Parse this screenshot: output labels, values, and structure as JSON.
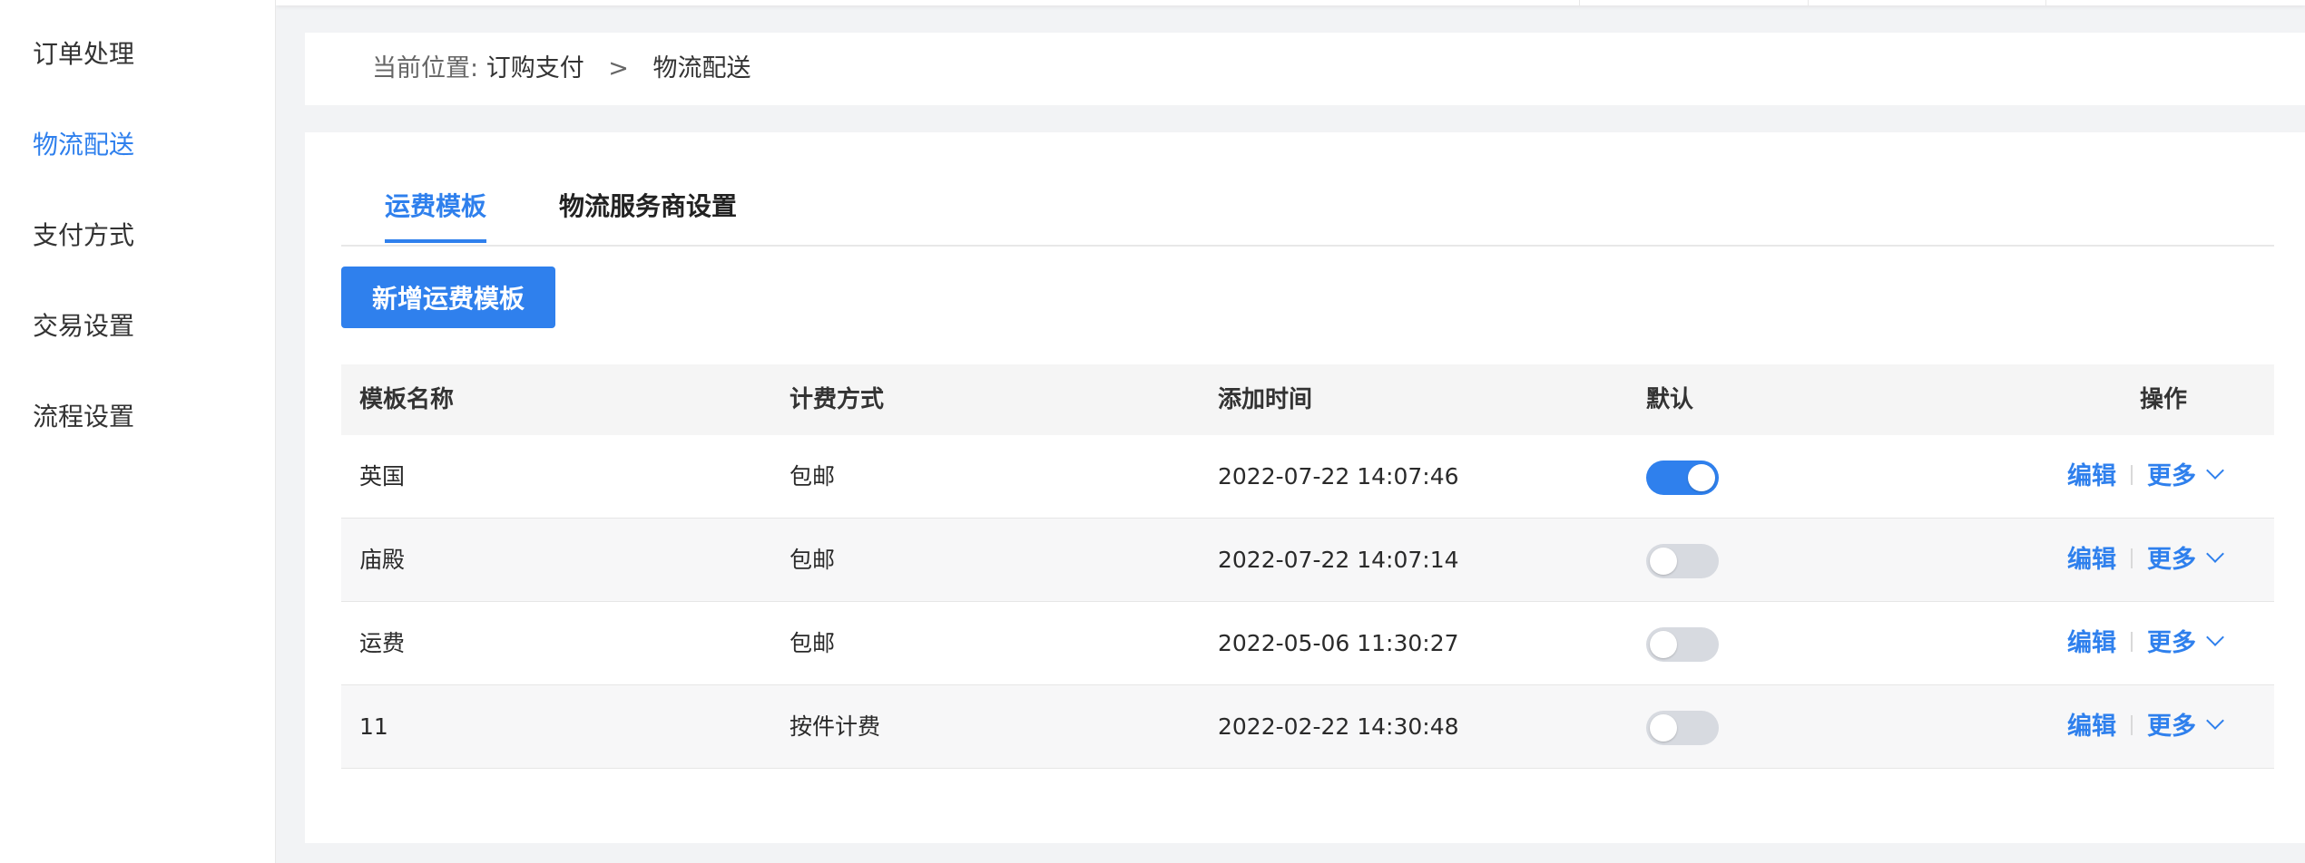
{
  "sidebar": {
    "items": [
      {
        "label": "订单处理",
        "active": false
      },
      {
        "label": "物流配送",
        "active": true
      },
      {
        "label": "支付方式",
        "active": false
      },
      {
        "label": "交易设置",
        "active": false
      },
      {
        "label": "流程设置",
        "active": false
      }
    ]
  },
  "breadcrumb": {
    "prefix": "当前位置:",
    "items": [
      "订购支付",
      "物流配送"
    ],
    "separator": ">"
  },
  "tabs": [
    {
      "label": "运费模板",
      "active": true
    },
    {
      "label": "物流服务商设置",
      "active": false
    }
  ],
  "toolbar": {
    "add_label": "新增运费模板"
  },
  "table": {
    "columns": [
      "模板名称",
      "计费方式",
      "添加时间",
      "默认",
      "操作"
    ],
    "rows": [
      {
        "name": "英国",
        "fee": "包邮",
        "time": "2022-07-22 14:07:46",
        "default": true
      },
      {
        "name": "庙殿",
        "fee": "包邮",
        "time": "2022-07-22 14:07:14",
        "default": false
      },
      {
        "name": "运费",
        "fee": "包邮",
        "time": "2022-05-06 11:30:27",
        "default": false
      },
      {
        "name": "11",
        "fee": "按件计费",
        "time": "2022-02-22 14:30:48",
        "default": false
      }
    ],
    "actions": {
      "edit": "编辑",
      "more": "更多"
    }
  },
  "colors": {
    "accent": "#2f80ed",
    "switch_off": "#d7dae0",
    "page_bg": "#f2f3f5"
  }
}
